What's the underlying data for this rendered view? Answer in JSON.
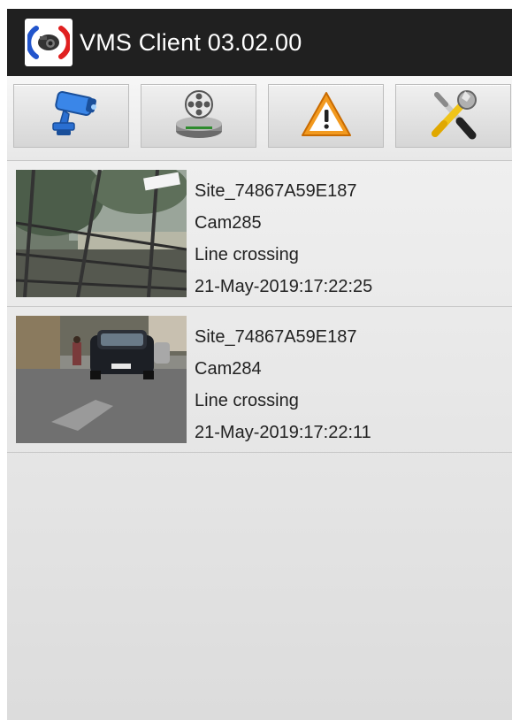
{
  "app": {
    "title": "VMS Client 03.02.00",
    "logo_icon": "vms-camera-logo-icon"
  },
  "toolbar": {
    "buttons": [
      {
        "icon": "cctv-camera-icon"
      },
      {
        "icon": "video-playback-icon"
      },
      {
        "icon": "alert-warning-icon"
      },
      {
        "icon": "settings-tools-icon"
      }
    ]
  },
  "events": [
    {
      "site": "Site_74867A59E187",
      "camera": "Cam285",
      "event_type": "Line crossing",
      "timestamp": "21-May-2019:17:22:25",
      "thumbnail": "balcony-railing-trees-snapshot"
    },
    {
      "site": "Site_74867A59E187",
      "camera": "Cam284",
      "event_type": "Line crossing",
      "timestamp": "21-May-2019:17:22:11",
      "thumbnail": "street-traffic-cars-snapshot"
    }
  ],
  "colors": {
    "titlebar": "#202020",
    "title_text": "#ffffff",
    "warning_orange": "#f29a1f",
    "camera_blue": "#2a6fd1"
  }
}
